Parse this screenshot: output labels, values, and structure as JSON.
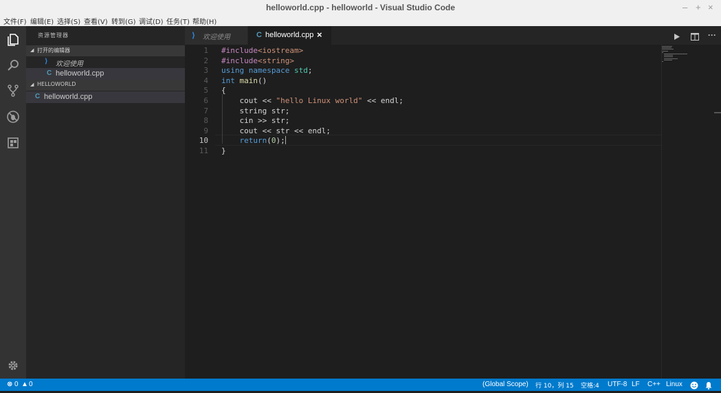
{
  "window": {
    "title": "helloworld.cpp - helloworld - Visual Studio Code",
    "controls": {
      "minimize": "–",
      "maximize": "+",
      "close": "×"
    }
  },
  "menu": [
    "文件(F)",
    "编辑(E)",
    "选择(S)",
    "查看(V)",
    "转到(G)",
    "调试(D)",
    "任务(T)",
    "帮助(H)"
  ],
  "activitybar": {
    "icons": [
      "explorer-icon",
      "search-icon",
      "source-control-icon",
      "debug-icon",
      "extensions-icon"
    ],
    "bottom_icon": "settings-gear-icon"
  },
  "sidebar": {
    "title": "资源管理器",
    "open_editors_label": "打开的编辑器",
    "open_editors": [
      {
        "label": "欢迎使用",
        "icon": "vscode-icon"
      },
      {
        "label": "helloworld.cpp",
        "icon": "cpp-file-icon"
      }
    ],
    "folder_label": "HELLOWORLD",
    "files": [
      {
        "label": "helloworld.cpp",
        "icon": "cpp-file-icon"
      }
    ]
  },
  "tabs": [
    {
      "label": "欢迎使用",
      "icon": "vscode-icon",
      "active": false
    },
    {
      "label": "helloworld.cpp",
      "icon": "cpp-file-icon",
      "active": true,
      "close": "×"
    }
  ],
  "editor": {
    "current_line": 10,
    "lines": [
      {
        "n": "1",
        "text": "#include<iostream>"
      },
      {
        "n": "2",
        "text": "#include<string>"
      },
      {
        "n": "3",
        "text": "using namespace std;"
      },
      {
        "n": "4",
        "text": "int main()"
      },
      {
        "n": "5",
        "text": "{"
      },
      {
        "n": "6",
        "text": "    cout << \"hello Linux world\" << endl;"
      },
      {
        "n": "7",
        "text": "    string str;"
      },
      {
        "n": "8",
        "text": "    cin >> str;"
      },
      {
        "n": "9",
        "text": "    cout << str << endl;"
      },
      {
        "n": "10",
        "text": "    return(0);"
      },
      {
        "n": "11",
        "text": "}"
      }
    ]
  },
  "status": {
    "errors": "0",
    "warnings": "0",
    "scope": "(Global Scope)",
    "position": "行 10，列 15",
    "indent": "空格:4",
    "encoding": "UTF-8",
    "eol": "LF",
    "language": "C++",
    "platform": "Linux"
  },
  "colors": {
    "statusbar": "#007acc",
    "activitybar": "#333333",
    "sidebar": "#252526",
    "editor": "#1e1e1e",
    "keyword": "#569cd6",
    "string": "#ce9178",
    "preprocessor": "#c586c0",
    "function": "#dcdcaa",
    "number": "#b5cea8"
  }
}
